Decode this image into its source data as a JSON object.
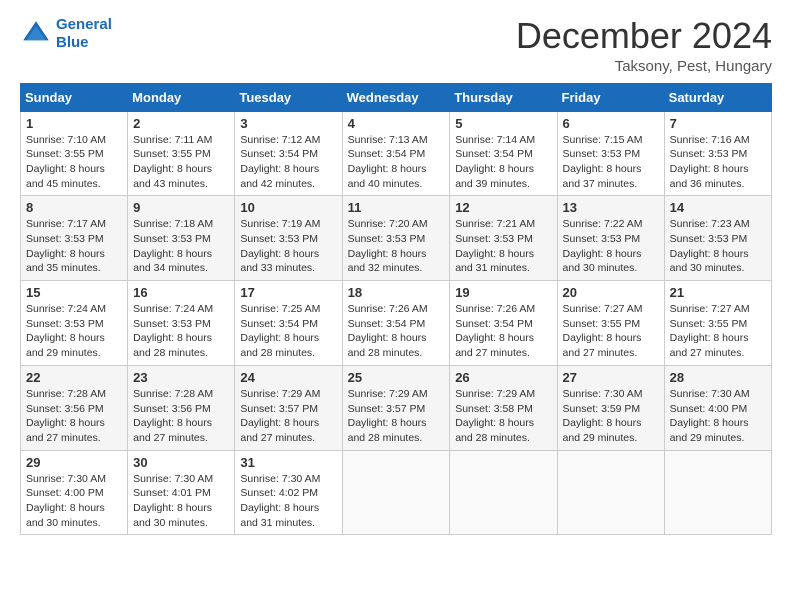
{
  "logo": {
    "line1": "General",
    "line2": "Blue"
  },
  "title": "December 2024",
  "location": "Taksony, Pest, Hungary",
  "headers": [
    "Sunday",
    "Monday",
    "Tuesday",
    "Wednesday",
    "Thursday",
    "Friday",
    "Saturday"
  ],
  "weeks": [
    [
      {
        "day": "1",
        "sunrise": "7:10 AM",
        "sunset": "3:55 PM",
        "daylight": "8 hours and 45 minutes."
      },
      {
        "day": "2",
        "sunrise": "7:11 AM",
        "sunset": "3:55 PM",
        "daylight": "8 hours and 43 minutes."
      },
      {
        "day": "3",
        "sunrise": "7:12 AM",
        "sunset": "3:54 PM",
        "daylight": "8 hours and 42 minutes."
      },
      {
        "day": "4",
        "sunrise": "7:13 AM",
        "sunset": "3:54 PM",
        "daylight": "8 hours and 40 minutes."
      },
      {
        "day": "5",
        "sunrise": "7:14 AM",
        "sunset": "3:54 PM",
        "daylight": "8 hours and 39 minutes."
      },
      {
        "day": "6",
        "sunrise": "7:15 AM",
        "sunset": "3:53 PM",
        "daylight": "8 hours and 37 minutes."
      },
      {
        "day": "7",
        "sunrise": "7:16 AM",
        "sunset": "3:53 PM",
        "daylight": "8 hours and 36 minutes."
      }
    ],
    [
      {
        "day": "8",
        "sunrise": "7:17 AM",
        "sunset": "3:53 PM",
        "daylight": "8 hours and 35 minutes."
      },
      {
        "day": "9",
        "sunrise": "7:18 AM",
        "sunset": "3:53 PM",
        "daylight": "8 hours and 34 minutes."
      },
      {
        "day": "10",
        "sunrise": "7:19 AM",
        "sunset": "3:53 PM",
        "daylight": "8 hours and 33 minutes."
      },
      {
        "day": "11",
        "sunrise": "7:20 AM",
        "sunset": "3:53 PM",
        "daylight": "8 hours and 32 minutes."
      },
      {
        "day": "12",
        "sunrise": "7:21 AM",
        "sunset": "3:53 PM",
        "daylight": "8 hours and 31 minutes."
      },
      {
        "day": "13",
        "sunrise": "7:22 AM",
        "sunset": "3:53 PM",
        "daylight": "8 hours and 30 minutes."
      },
      {
        "day": "14",
        "sunrise": "7:23 AM",
        "sunset": "3:53 PM",
        "daylight": "8 hours and 30 minutes."
      }
    ],
    [
      {
        "day": "15",
        "sunrise": "7:24 AM",
        "sunset": "3:53 PM",
        "daylight": "8 hours and 29 minutes."
      },
      {
        "day": "16",
        "sunrise": "7:24 AM",
        "sunset": "3:53 PM",
        "daylight": "8 hours and 28 minutes."
      },
      {
        "day": "17",
        "sunrise": "7:25 AM",
        "sunset": "3:54 PM",
        "daylight": "8 hours and 28 minutes."
      },
      {
        "day": "18",
        "sunrise": "7:26 AM",
        "sunset": "3:54 PM",
        "daylight": "8 hours and 28 minutes."
      },
      {
        "day": "19",
        "sunrise": "7:26 AM",
        "sunset": "3:54 PM",
        "daylight": "8 hours and 27 minutes."
      },
      {
        "day": "20",
        "sunrise": "7:27 AM",
        "sunset": "3:55 PM",
        "daylight": "8 hours and 27 minutes."
      },
      {
        "day": "21",
        "sunrise": "7:27 AM",
        "sunset": "3:55 PM",
        "daylight": "8 hours and 27 minutes."
      }
    ],
    [
      {
        "day": "22",
        "sunrise": "7:28 AM",
        "sunset": "3:56 PM",
        "daylight": "8 hours and 27 minutes."
      },
      {
        "day": "23",
        "sunrise": "7:28 AM",
        "sunset": "3:56 PM",
        "daylight": "8 hours and 27 minutes."
      },
      {
        "day": "24",
        "sunrise": "7:29 AM",
        "sunset": "3:57 PM",
        "daylight": "8 hours and 27 minutes."
      },
      {
        "day": "25",
        "sunrise": "7:29 AM",
        "sunset": "3:57 PM",
        "daylight": "8 hours and 28 minutes."
      },
      {
        "day": "26",
        "sunrise": "7:29 AM",
        "sunset": "3:58 PM",
        "daylight": "8 hours and 28 minutes."
      },
      {
        "day": "27",
        "sunrise": "7:30 AM",
        "sunset": "3:59 PM",
        "daylight": "8 hours and 29 minutes."
      },
      {
        "day": "28",
        "sunrise": "7:30 AM",
        "sunset": "4:00 PM",
        "daylight": "8 hours and 29 minutes."
      }
    ],
    [
      {
        "day": "29",
        "sunrise": "7:30 AM",
        "sunset": "4:00 PM",
        "daylight": "8 hours and 30 minutes."
      },
      {
        "day": "30",
        "sunrise": "7:30 AM",
        "sunset": "4:01 PM",
        "daylight": "8 hours and 30 minutes."
      },
      {
        "day": "31",
        "sunrise": "7:30 AM",
        "sunset": "4:02 PM",
        "daylight": "8 hours and 31 minutes."
      },
      null,
      null,
      null,
      null
    ]
  ],
  "labels": {
    "sunrise": "Sunrise:",
    "sunset": "Sunset:",
    "daylight": "Daylight:"
  }
}
